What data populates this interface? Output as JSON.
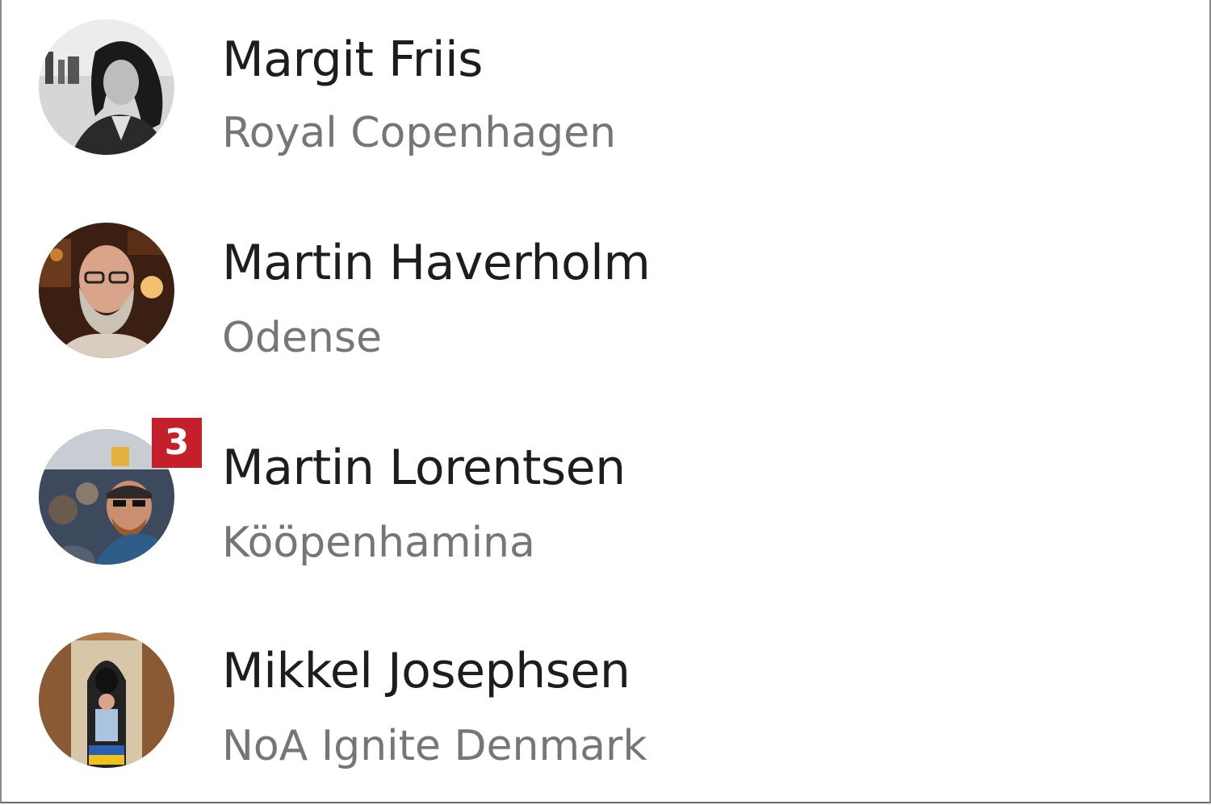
{
  "contacts": [
    {
      "name": "Margit Friis",
      "subtitle": "Royal Copenhagen",
      "badge": "",
      "avatar": "avatar-photo"
    },
    {
      "name": "Martin Haverholm",
      "subtitle": "Odense",
      "badge": "",
      "avatar": "avatar-photo"
    },
    {
      "name": "Martin Lorentsen",
      "subtitle": "Kööpenhamina",
      "badge": "3",
      "avatar": "avatar-photo"
    },
    {
      "name": "Mikkel Josephsen",
      "subtitle": "NoA Ignite Denmark",
      "badge": "",
      "avatar": "avatar-photo"
    }
  ],
  "colors": {
    "name_text": "#1d1d1d",
    "subtitle_text": "#767676",
    "badge_background": "#c3202c",
    "border": "#8a8a8a"
  }
}
